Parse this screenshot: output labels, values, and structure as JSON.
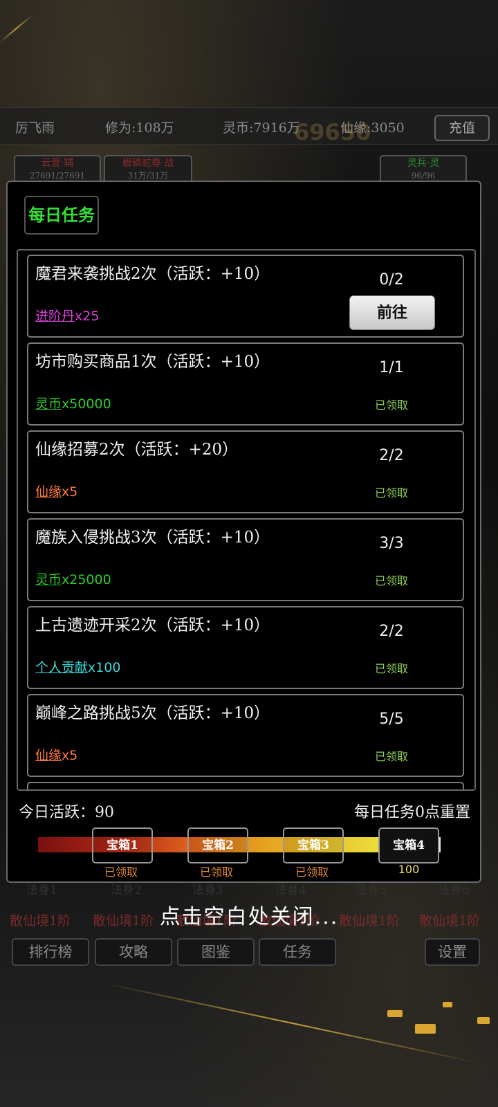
{
  "status": {
    "name": "厉飞雨",
    "cultivation": "修为:108万",
    "spirit_coin": "灵币:7916万",
    "immortal_fate": "仙缘:3050",
    "recharge": "充值",
    "power": "69650"
  },
  "heroes": [
    {
      "name": "云萱·辅",
      "hp": "27691/27691"
    },
    {
      "name": "碧磷蛇尊·战",
      "hp": "31万/31万"
    },
    {
      "name": "灵兵·灵",
      "hp": "96/96"
    }
  ],
  "modal": {
    "title": "每日任务",
    "tasks": [
      {
        "name": "魔君来袭挑战2次（活跃：+10）",
        "reward_name": "进阶丹",
        "reward_qty": "x25",
        "reward_color": "#e040e0",
        "progress": "0/2",
        "action": "前往"
      },
      {
        "name": "坊市购买商品1次（活跃：+10）",
        "reward_name": "灵币",
        "reward_qty": "x50000",
        "reward_color": "#2ecc2e",
        "progress": "1/1",
        "status": "已领取"
      },
      {
        "name": "仙缘招募2次（活跃：+20）",
        "reward_name": "仙缘",
        "reward_qty": "x5",
        "reward_color": "#ff7a3d",
        "progress": "2/2",
        "status": "已领取"
      },
      {
        "name": "魔族入侵挑战3次（活跃：+10）",
        "reward_name": "灵币",
        "reward_qty": "x25000",
        "reward_color": "#2ecc2e",
        "progress": "3/3",
        "status": "已领取"
      },
      {
        "name": "上古遗迹开采2次（活跃：+10）",
        "reward_name": "个人贡献",
        "reward_qty": "x100",
        "reward_color": "#3cd6d6",
        "progress": "2/2",
        "status": "已领取"
      },
      {
        "name": "巅峰之路挑战5次（活跃：+10）",
        "reward_name": "仙缘",
        "reward_qty": "x5",
        "reward_color": "#ff7a3d",
        "progress": "5/5",
        "status": "已领取"
      }
    ],
    "activity_label": "今日活跃：90",
    "reset_label": "每日任务0点重置",
    "activity_progress_fraction": 0.87,
    "chests": [
      {
        "label": "宝箱1",
        "status": "已领取"
      },
      {
        "label": "宝箱2",
        "status": "已领取"
      },
      {
        "label": "宝箱3",
        "status": "已领取"
      },
      {
        "label": "宝箱4",
        "status": "100"
      }
    ]
  },
  "close_hint": "点击空白处关闭...",
  "realms": [
    "散仙境1阶",
    "散仙境1阶",
    "散仙境1阶",
    "散仙境1阶",
    "散仙境1阶",
    "散仙境1阶"
  ],
  "skills": [
    "法身1",
    "法身2",
    "法身3",
    "法身4",
    "法身5",
    "法身6"
  ],
  "nav": {
    "ranking": "排行榜",
    "guide": "攻略",
    "codex": "图鉴",
    "tasks": "任务",
    "settings": "设置"
  },
  "colors": {
    "title_green": "#35e035",
    "done_green": "#8fcf54",
    "chest_status": "#e08a3a",
    "chest_pending": "#f0e060"
  }
}
